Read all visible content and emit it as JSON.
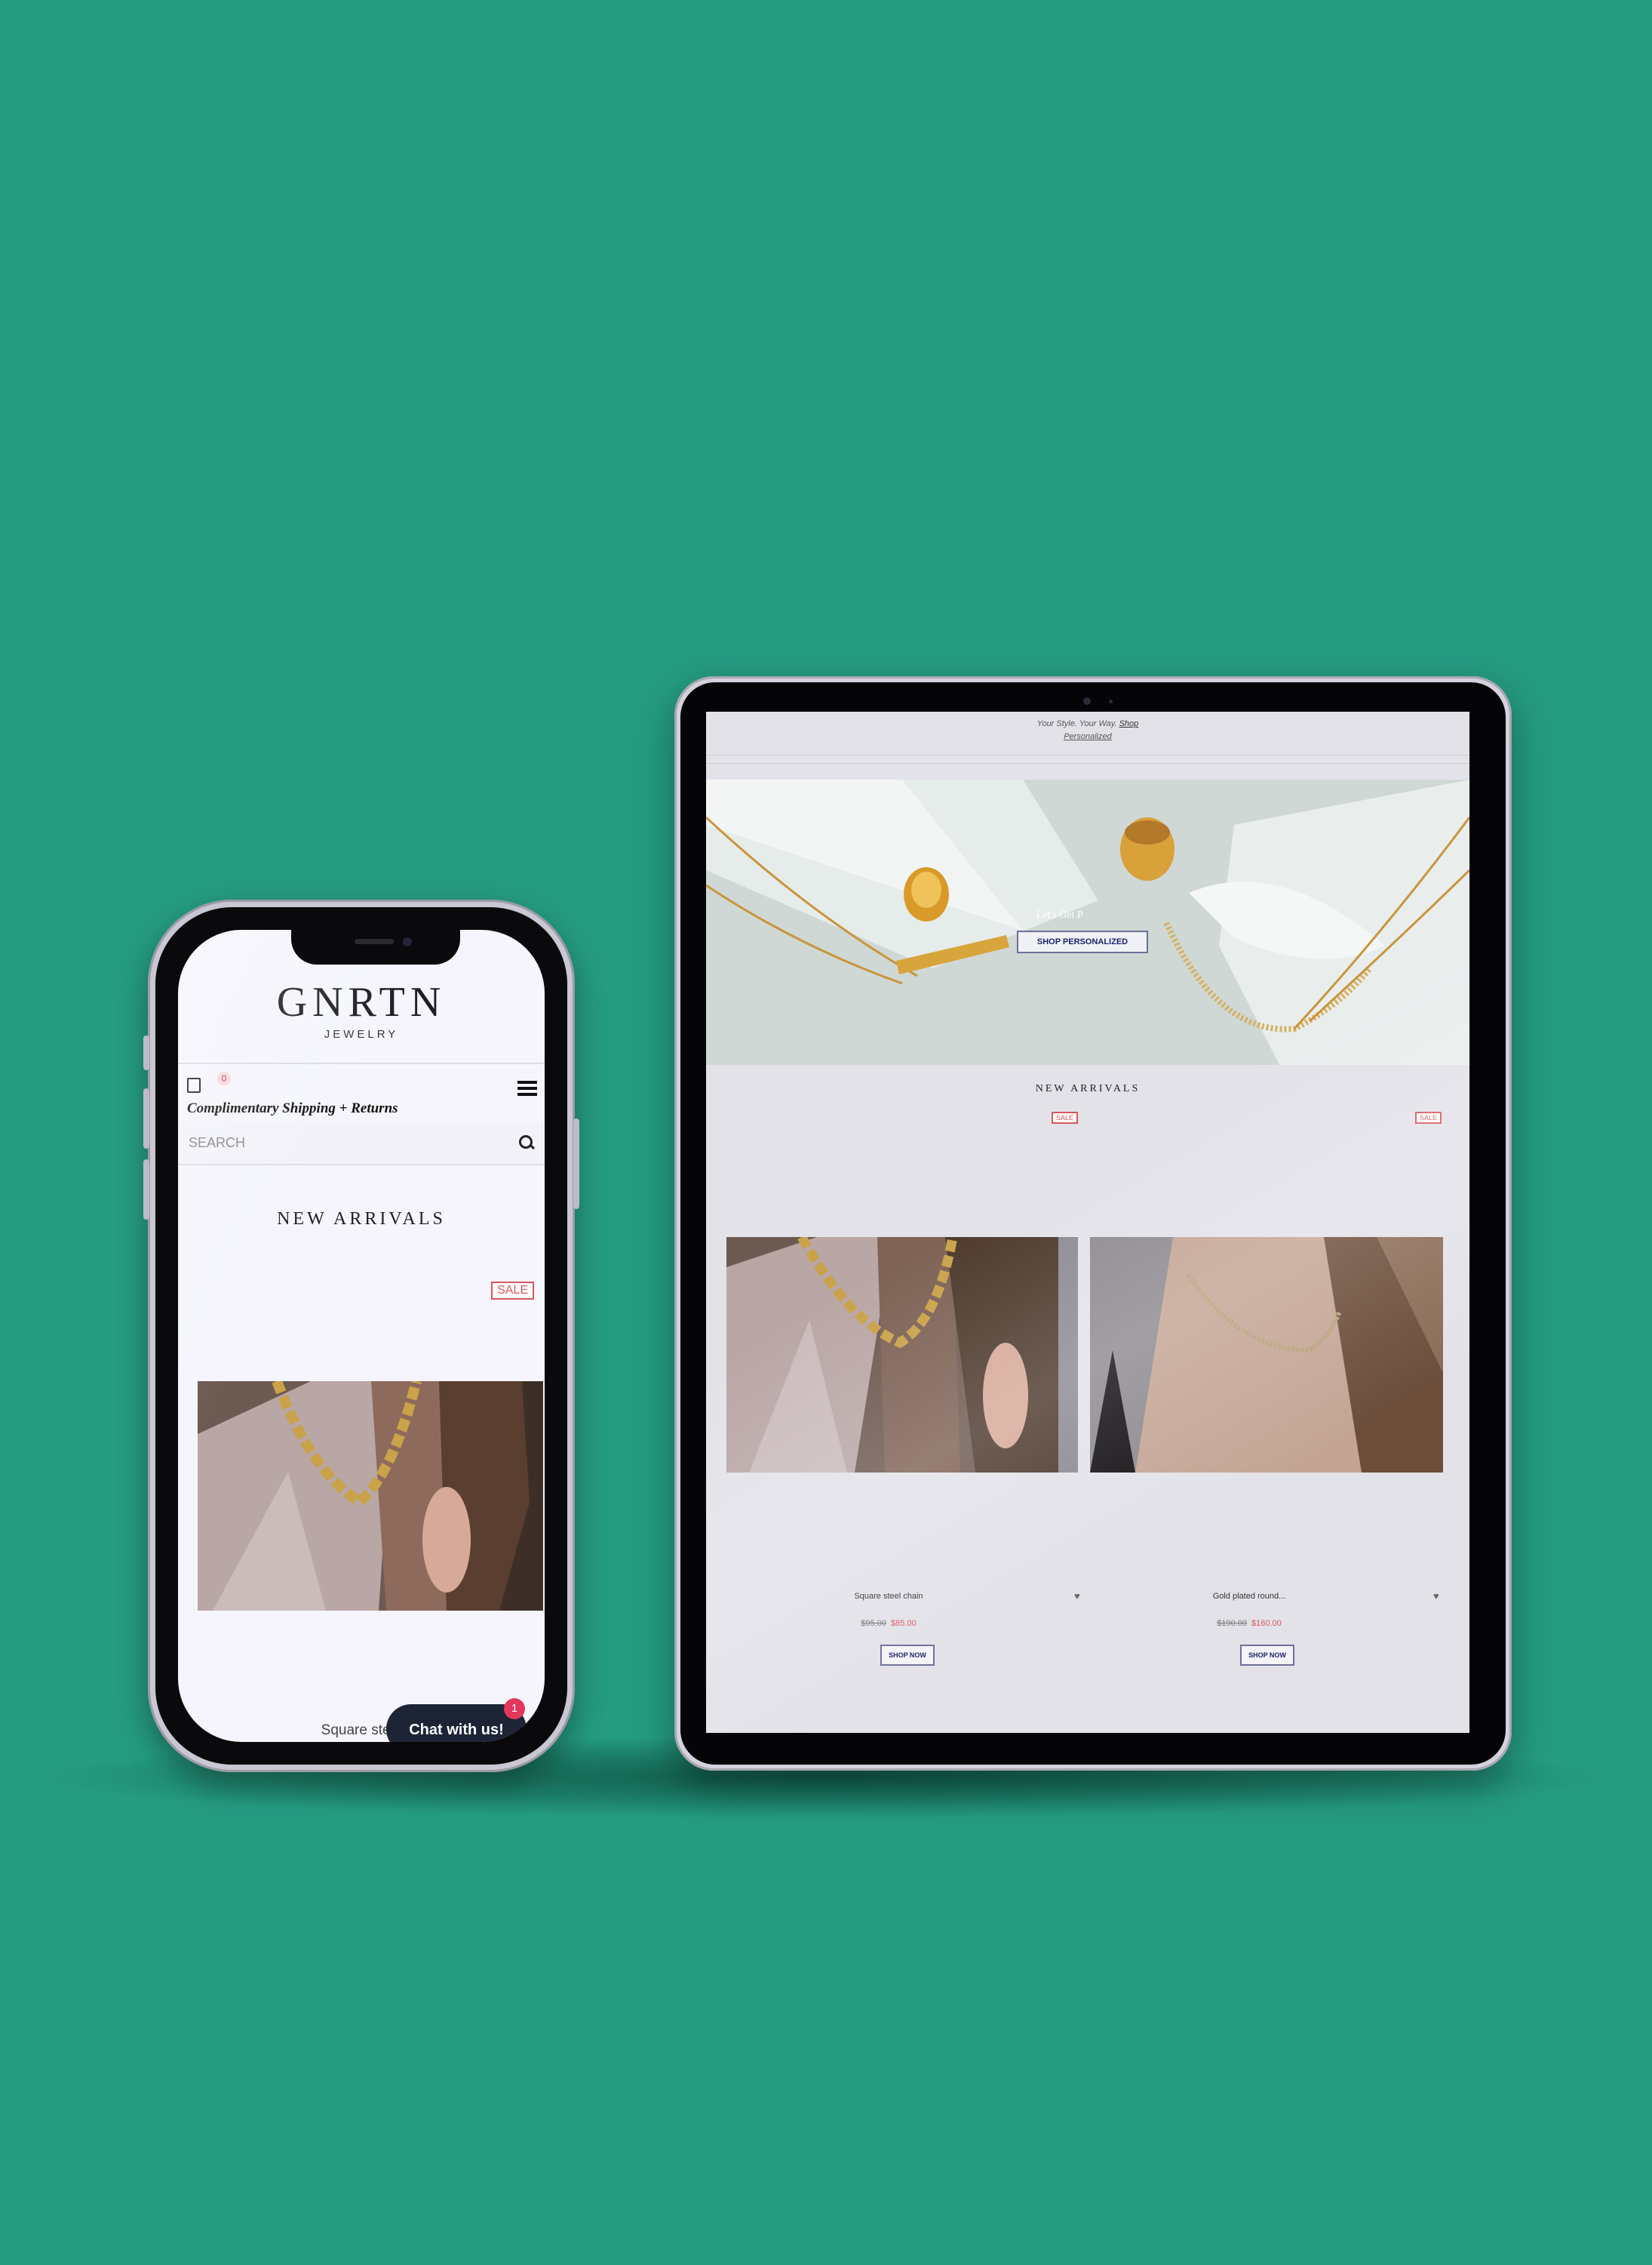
{
  "background_color": "#259b80",
  "phone": {
    "logo": "GNRTN",
    "logo_sub": "JEWELRY",
    "cart_count": "0",
    "shipping_banner": "Complimentary Shipping + Returns",
    "search_placeholder": "SEARCH",
    "section_title": "NEW ARRIVALS",
    "sale_badge": "SALE",
    "product_name": "Square steel",
    "chat_label": "Chat with us!",
    "chat_badge": "1"
  },
  "tablet": {
    "promo_text": "Your Style. Your Way.",
    "promo_link": "Shop",
    "promo_link2": "Personalized",
    "hero_text": "Let's Get P",
    "hero_button": "SHOP PERSONALIZED",
    "section_title": "NEW ARRIVALS",
    "products": [
      {
        "sale_badge": "SALE",
        "name": "Square steel chain",
        "old_price": "$95.00",
        "new_price": "$85.00",
        "button": "SHOP NOW"
      },
      {
        "sale_badge": "SALE",
        "name": "Gold plated round...",
        "old_price": "$190.00",
        "new_price": "$160.00",
        "button": "SHOP NOW"
      }
    ]
  },
  "colors": {
    "sale_red": "#d9585c",
    "navy": "#1c1f6e",
    "chat_bg": "#1d2436",
    "chat_badge": "#e2375a"
  },
  "icons": [
    "shopping-bag-icon",
    "hamburger-menu-icon",
    "search-icon",
    "heart-icon"
  ]
}
